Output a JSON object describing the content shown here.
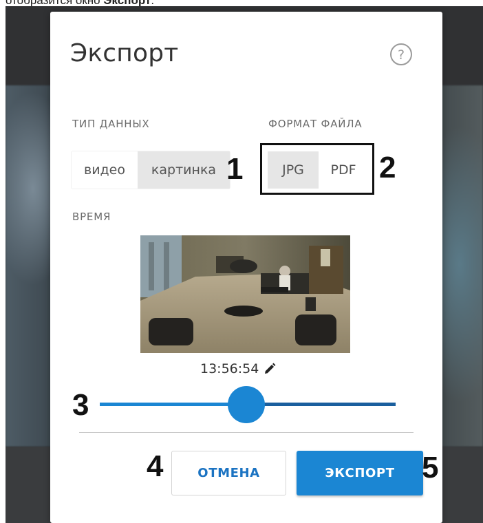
{
  "caption": {
    "prefix": "отобразится окно ",
    "bold": "Экспорт",
    "suffix": "."
  },
  "dialog": {
    "title": "Экспорт",
    "help_icon": "help-circle-icon"
  },
  "data_type": {
    "label": "ТИП ДАННЫХ",
    "options": [
      "видео",
      "картинка"
    ],
    "selected": "картинка"
  },
  "file_format": {
    "label": "ФОРМАТ ФАЙЛА",
    "options": [
      "JPG",
      "PDF"
    ],
    "selected": "JPG"
  },
  "time": {
    "label": "ВРЕМЯ",
    "timestamp": "13:56:54",
    "edit_icon": "pencil-icon",
    "slider_position": 0.45
  },
  "buttons": {
    "cancel": "ОТМЕНА",
    "export": "ЭКСПОРТ"
  },
  "callouts": [
    "1",
    "2",
    "3",
    "4",
    "5"
  ],
  "colors": {
    "accent": "#1b86d3",
    "accent_dark": "#1a5f9e",
    "segment_active": "#e6e6e6"
  }
}
